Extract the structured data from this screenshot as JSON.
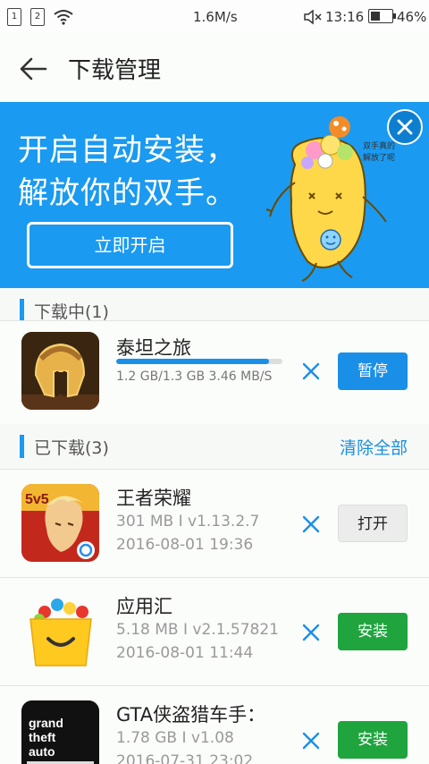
{
  "status_bar": {
    "sim1": "1",
    "sim2": "2",
    "speed": "1.6M/s",
    "time": "13:16",
    "battery": "46%",
    "battery_level": 0.46
  },
  "header": {
    "title": "下载管理"
  },
  "banner": {
    "line1": "开启自动安装，",
    "line2": "解放你的双手。",
    "button": "立即开启",
    "mascot_note": "双手真的解放了呢"
  },
  "downloading": {
    "label": "下载中(1)",
    "items": [
      {
        "name": "泰坦之旅",
        "progress": 0.92,
        "progress_text": "1.2 GB/1.3 GB  3.46 MB/S",
        "action": "暂停"
      }
    ]
  },
  "downloaded": {
    "label": "已下载(3)",
    "clear_label": "清除全部",
    "items": [
      {
        "name": "王者荣耀",
        "meta1": "301 MB I v1.13.2.7",
        "meta2": "2016-08-01 19:36",
        "action": "打开"
      },
      {
        "name": "应用汇",
        "meta1": "5.18 MB I v2.1.57821",
        "meta2": "2016-08-01 11:44",
        "action": "安装"
      },
      {
        "name": "GTA侠盗猎车手：",
        "meta1": "1.78 GB I v1.08",
        "meta2": "2016-07-31 23:02",
        "action": "安装"
      }
    ]
  },
  "colors": {
    "accent": "#1a9af0",
    "install": "#1fa43e"
  }
}
